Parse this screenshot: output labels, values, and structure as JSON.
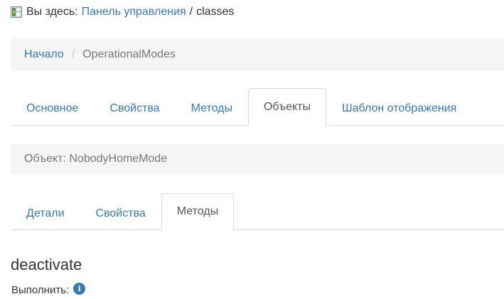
{
  "location": {
    "prefix": "Вы здесь:",
    "panel_link": "Панель управления",
    "separator": "/",
    "current": "classes"
  },
  "breadcrumb": {
    "home": "Начало",
    "divider": "/",
    "current": "OperationalModes"
  },
  "main_tabs": [
    {
      "label": "Основное",
      "active": false
    },
    {
      "label": "Свойства",
      "active": false
    },
    {
      "label": "Методы",
      "active": false
    },
    {
      "label": "Объекты",
      "active": true
    },
    {
      "label": "Шаблон отображения",
      "active": false
    }
  ],
  "object": {
    "label": "Объект: NobodyHomeMode"
  },
  "sub_tabs": [
    {
      "label": "Детали",
      "active": false
    },
    {
      "label": "Свойства",
      "active": false
    },
    {
      "label": "Методы",
      "active": true
    }
  ],
  "method": {
    "name": "deactivate",
    "run_label": "Выполнить:",
    "info_glyph": "i"
  },
  "colors": {
    "link": "#337ab7",
    "well_bg": "#f5f5f5",
    "active_tab_text": "#555555",
    "muted": "#777777",
    "border": "#dddddd"
  },
  "icons": {
    "home": "control-panel-icon",
    "info": "info-icon"
  }
}
